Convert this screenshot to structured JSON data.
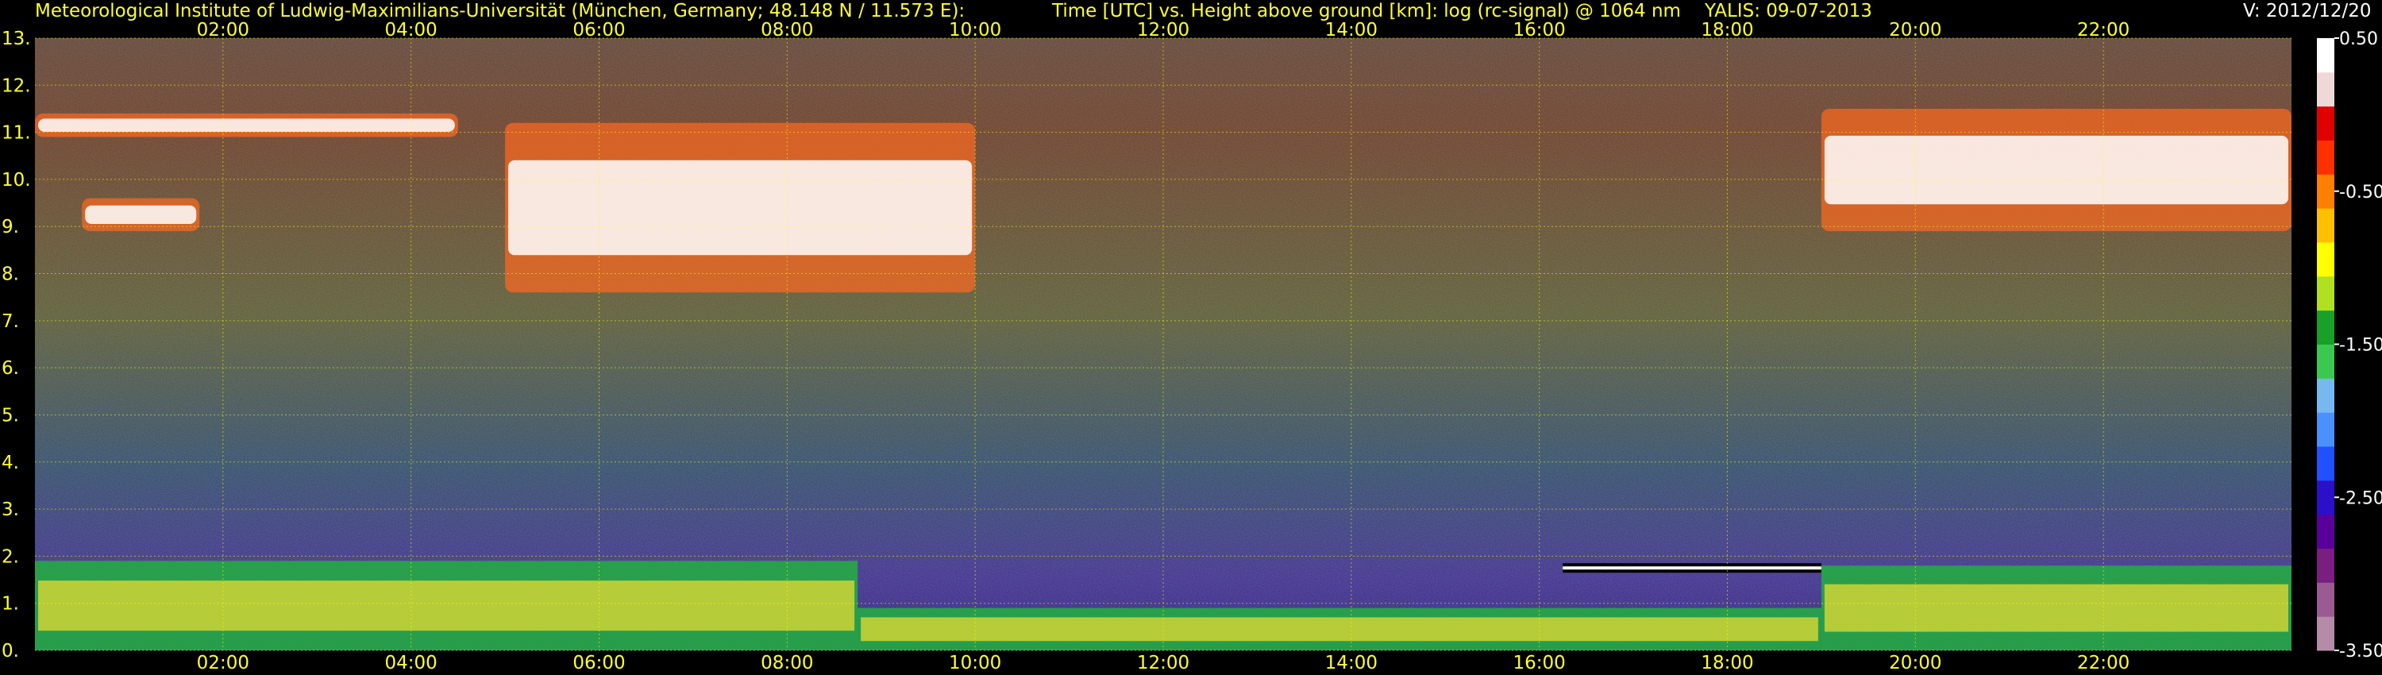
{
  "header": {
    "institute": "Meteorological Institute of Ludwig-Maximilians-Universität (München, Germany; 48.148 N / 11.573 E):",
    "description": "Time [UTC] vs. Height above ground [km]: log (rc-signal) @ 1064 nm",
    "station_date": "YALIS: 09-07-2013",
    "version": "V: 2012/12/20"
  },
  "colors": {
    "background": "#000000",
    "text": "#ffff33",
    "grid": "#ffff00",
    "colorbar": [
      "#b48ca8",
      "#9a5a92",
      "#7a1e82",
      "#5a009a",
      "#2a10c8",
      "#2050ff",
      "#4a90ff",
      "#78b8f0",
      "#3cc850",
      "#18a028",
      "#b0e020",
      "#ffff00",
      "#ffc000",
      "#ff8000",
      "#ff3000",
      "#e00000",
      "#f0d8d8",
      "#ffffff"
    ]
  },
  "chart_data": {
    "type": "heatmap",
    "title": "Time [UTC] vs. Height above ground [km]: log (rc-signal) @ 1064 nm",
    "xlabel": "Time [UTC]",
    "ylabel": "Height above ground [km]",
    "x_range_hours": [
      0,
      24
    ],
    "y_range_km": [
      0,
      13
    ],
    "x_ticks": [
      "02:00",
      "04:00",
      "06:00",
      "08:00",
      "10:00",
      "12:00",
      "14:00",
      "16:00",
      "18:00",
      "20:00",
      "22:00"
    ],
    "y_ticks": [
      "0.",
      "1.",
      "2.",
      "3.",
      "4.",
      "5.",
      "6.",
      "7.",
      "8.",
      "9.",
      "10.",
      "11.",
      "12.",
      "13."
    ],
    "colorbar": {
      "range": [
        -3.5,
        0.5
      ],
      "tick_labels": [
        "0.50",
        "-0.50",
        "-1.50",
        "-2.50",
        "-3.50"
      ],
      "tick_values": [
        0.5,
        -0.5,
        -1.5,
        -2.5,
        -3.5
      ]
    },
    "grid": true,
    "features": [
      {
        "name": "boundary layer aerosol",
        "start": "00:00",
        "end": "08:45",
        "top_km": 1.9
      },
      {
        "name": "boundary layer aerosol",
        "start": "08:45",
        "end": "19:00",
        "top_km": 0.9
      },
      {
        "name": "boundary layer cloud top",
        "start": "16:15",
        "end": "19:00",
        "height_km": 1.75
      },
      {
        "name": "boundary layer aerosol",
        "start": "19:00",
        "end": "24:00",
        "top_km": 1.8
      },
      {
        "name": "cirrus",
        "start": "00:00",
        "end": "04:30",
        "base_km": 10.9,
        "top_km": 11.4
      },
      {
        "name": "cirrus",
        "start": "00:30",
        "end": "01:45",
        "base_km": 8.9,
        "top_km": 9.6
      },
      {
        "name": "cirrus",
        "start": "05:00",
        "end": "10:00",
        "base_km": 7.6,
        "top_km": 11.2
      },
      {
        "name": "cirrus",
        "start": "19:00",
        "end": "24:00",
        "base_km": 8.9,
        "top_km": 11.5
      }
    ]
  }
}
